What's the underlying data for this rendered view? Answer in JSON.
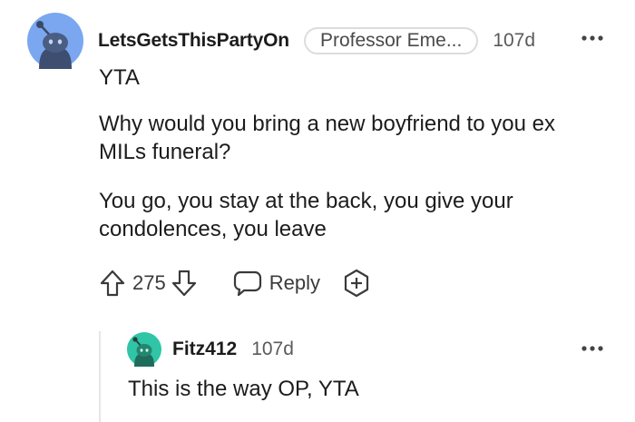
{
  "comment": {
    "username": "LetsGetsThisPartyOn",
    "flair": "Professor Eme...",
    "timestamp": "107d",
    "avatar_icon": "snoo-avatar-icon",
    "avatar_bg": "#7aa7f0",
    "more_icon": "more-options-icon",
    "paragraphs": [
      "YTA",
      "Why would you bring a new boyfriend to you ex MILs funeral?",
      "You go, you stay at the back, you give your condolences, you leave"
    ],
    "score": "275",
    "upvote_icon": "upvote-arrow-icon",
    "downvote_icon": "downvote-arrow-icon",
    "reply_icon": "speech-bubble-icon",
    "reply_label": "Reply",
    "award_icon": "award-plus-icon"
  },
  "reply": {
    "username": "Fitz412",
    "timestamp": "107d",
    "avatar_icon": "snoo-avatar-icon",
    "avatar_bg": "#2fc5a6",
    "more_icon": "more-options-icon",
    "text": "This is the way OP, YTA"
  }
}
